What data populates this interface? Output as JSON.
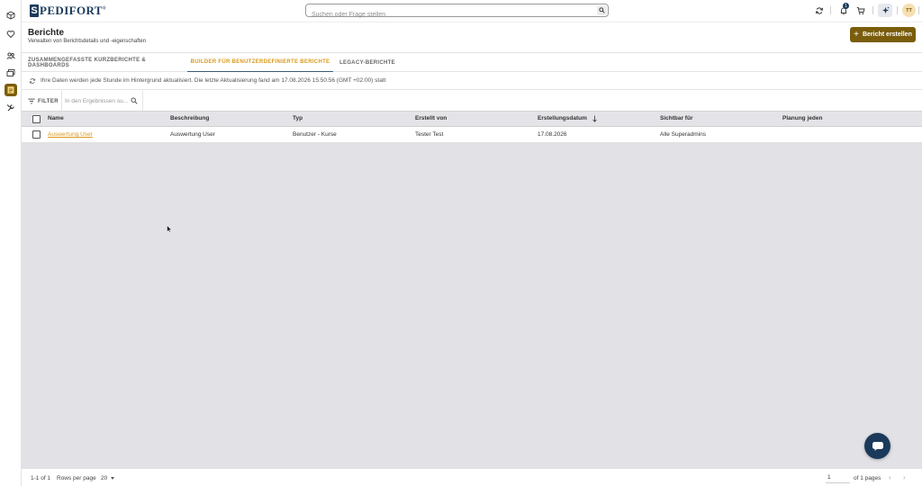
{
  "app": {
    "logo_letter": "S",
    "logo_text": "PEDIFORT",
    "logo_reg": "®",
    "search_placeholder": "Suchen oder Frage stellen",
    "notifications_count": "1",
    "avatar_initials": "TT"
  },
  "sidebar": {
    "icons": [
      "cube-icon",
      "heart-icon",
      "users-icon",
      "folders-icon",
      "reports-icon",
      "tools-icon"
    ],
    "active": "reports-icon"
  },
  "header": {
    "title": "Berichte",
    "subtitle": "Verwalten von Berichtsdetails und -eigenschaften",
    "create_button": "Bericht erstellen"
  },
  "tabs": [
    {
      "label": "Zusammengefasste Kurzberichte & Dashboards",
      "active": false
    },
    {
      "label": "Builder für benutzerdefinierte Berichte",
      "active": true
    },
    {
      "label": "Legacy-Berichte",
      "active": false
    }
  ],
  "info_text": "Ihre Daten werden jede Stunde im Hintergrund aktualisiert. Die letzte Aktualisierung fand am 17.08.2026 15:50:56 (GMT +02:00) statt",
  "filter": {
    "label": "FILTER",
    "search_placeholder": "In den Ergebnissen su..."
  },
  "table": {
    "columns": [
      "Name",
      "Beschreibung",
      "Typ",
      "Erstellt von",
      "Erstellungsdatum",
      "Sichtbar für",
      "Planung jeden"
    ],
    "sorted_column": "Erstellungsdatum",
    "sort_direction": "descending",
    "rows": [
      [
        "Auswertung User",
        "Auswertung User",
        "Benutzer - Kurse",
        "Tester Test",
        "17.08.2026",
        "Alle Superadmins",
        ""
      ]
    ]
  },
  "footer": {
    "range": "1-1 of 1",
    "rows_per_page_label": "Rows per page",
    "rows_per_page_value": "20",
    "current_page": "1",
    "pages_text": "of 1 pages"
  },
  "colors": {
    "brand_navy": "#1b3a5b",
    "accent_gold": "#7a5d0c",
    "tab_active": "#d89a1c",
    "table_bg": "#e1e1e6"
  }
}
